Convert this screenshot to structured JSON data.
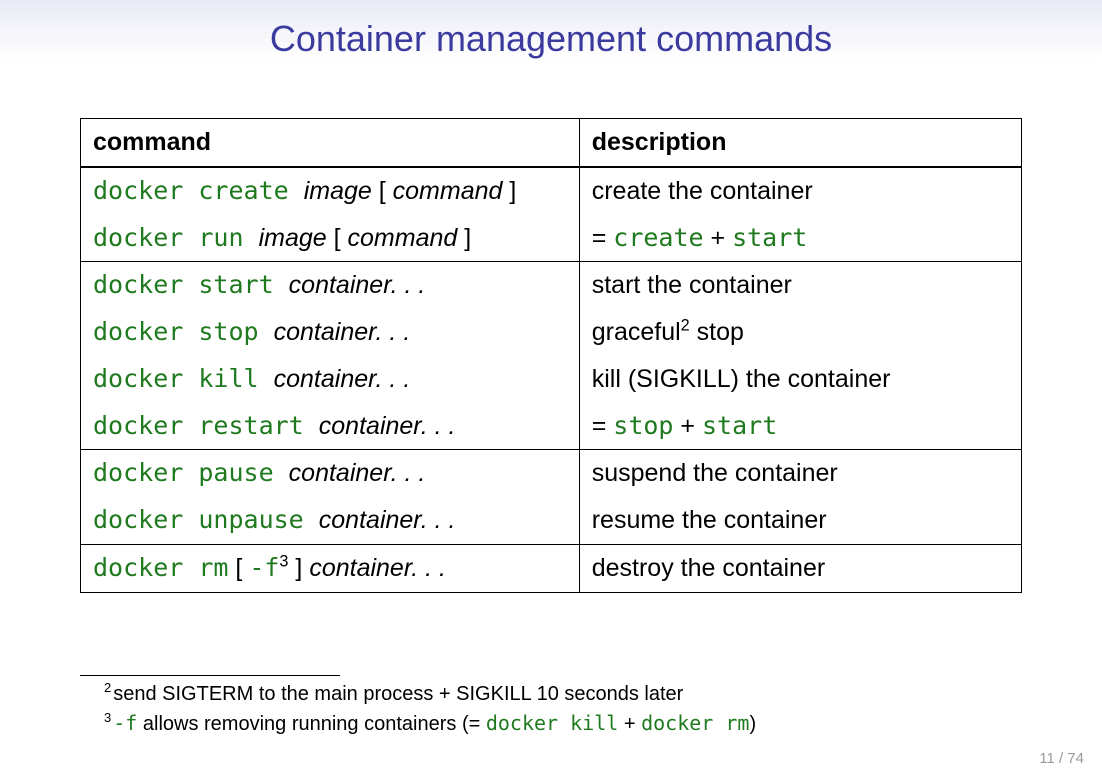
{
  "title": "Container management commands",
  "headers": {
    "command": "command",
    "description": "description"
  },
  "rows": [
    {
      "cmd_pre": "docker create ",
      "args": "image",
      "post_sym": " [ ",
      "args2": "command",
      "post_sym2": " ]",
      "desc_plain": "create the container",
      "desc_mode": "plain",
      "top_of_group": true,
      "last_of_group": false
    },
    {
      "cmd_pre": "docker run ",
      "args": "image",
      "post_sym": " [ ",
      "args2": "command",
      "post_sym2": " ]",
      "desc_mode": "eq2",
      "eq_a": "create",
      "eq_b": "start",
      "top_of_group": false,
      "last_of_group": true
    },
    {
      "cmd_pre": "docker start ",
      "args": "container. . .",
      "desc_plain": "start the container",
      "desc_mode": "plain",
      "top_of_group": true,
      "last_of_group": false
    },
    {
      "cmd_pre": "docker stop ",
      "args": "container. . .",
      "desc_mode": "graceful",
      "graceful_word": "graceful",
      "graceful_sup": "2",
      "graceful_tail": " stop",
      "top_of_group": false,
      "last_of_group": false
    },
    {
      "cmd_pre": "docker kill ",
      "args": "container. . .",
      "desc_plain": "kill (SIGKILL) the container",
      "desc_mode": "plain",
      "top_of_group": false,
      "last_of_group": false
    },
    {
      "cmd_pre": "docker restart ",
      "args": "container. . .",
      "desc_mode": "eq2",
      "eq_a": "stop",
      "eq_b": "start",
      "top_of_group": false,
      "last_of_group": true
    },
    {
      "cmd_pre": "docker pause ",
      "args": "container. . .",
      "desc_plain": "suspend the container",
      "desc_mode": "plain",
      "top_of_group": true,
      "last_of_group": false
    },
    {
      "cmd_pre": "docker unpause ",
      "args": "container. . .",
      "desc_plain": "resume the container",
      "desc_mode": "plain",
      "top_of_group": false,
      "last_of_group": true
    },
    {
      "cmd_pre": "docker rm",
      "mid_sym": " [ ",
      "flag": "-f",
      "flag_sup": "3",
      "end_sym": " ] ",
      "args": "container. . .",
      "desc_plain": "destroy the container",
      "desc_mode": "plain",
      "top_of_group": true,
      "last_of_group": true
    }
  ],
  "footnotes": {
    "f2": {
      "num": "2",
      "text_a": "send SIGTERM to the main process + SIGKILL 10 seconds later"
    },
    "f3": {
      "num": "3",
      "flag": "-f",
      "text_a": " allows removing running containers (= ",
      "code_a": "docker kill",
      "plus": " + ",
      "code_b": "docker rm",
      "tail": ")"
    }
  },
  "page": "11 / 74"
}
